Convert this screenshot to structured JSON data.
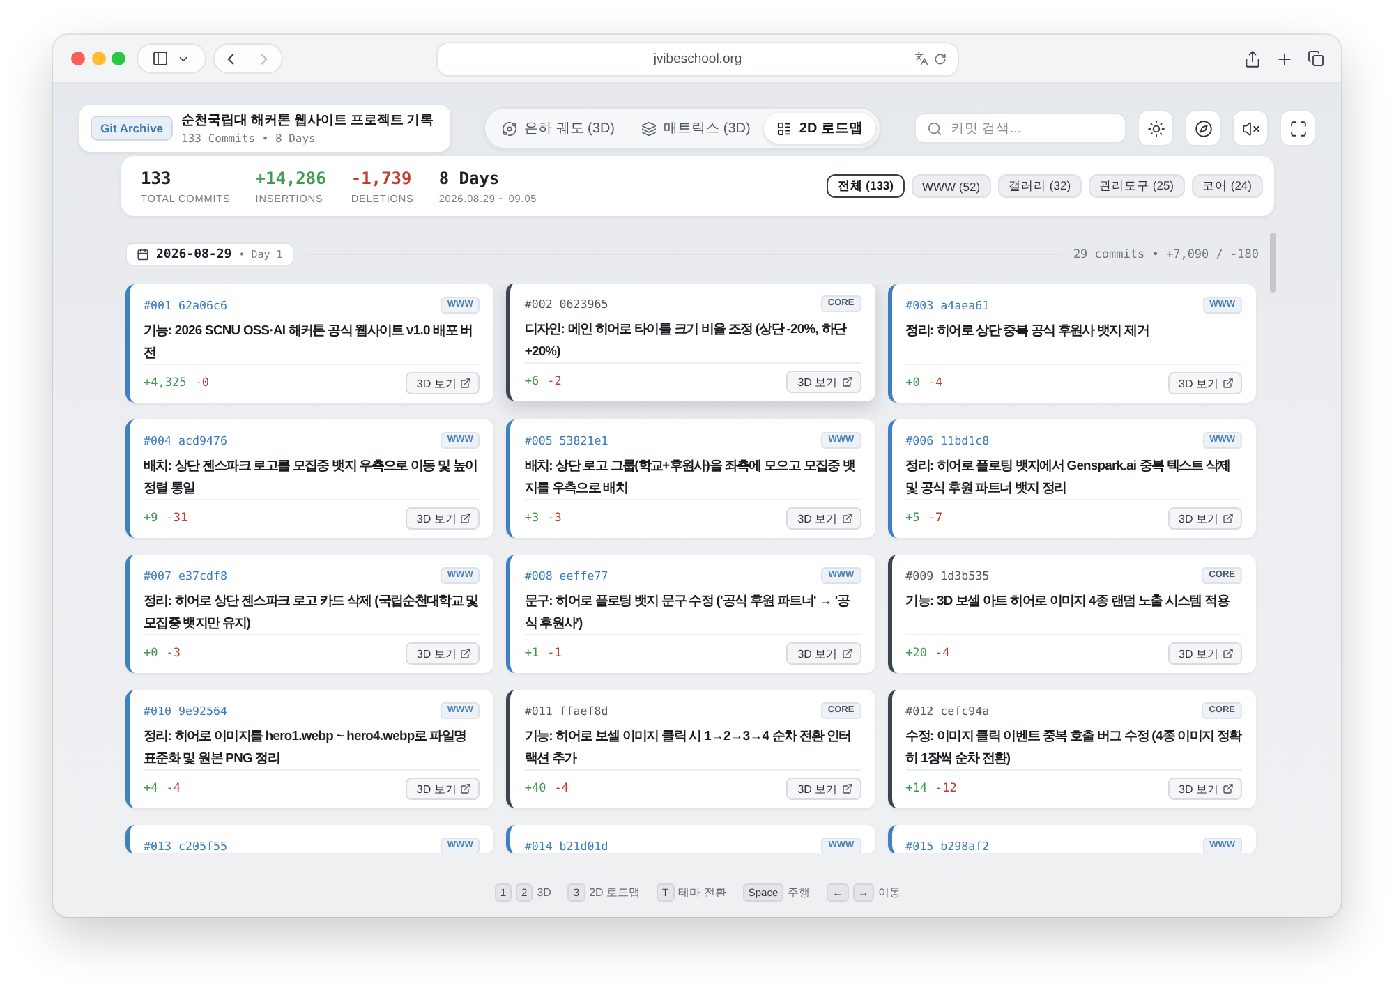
{
  "browser": {
    "url": "jvibeschool.org",
    "back_disabled": false,
    "forward_disabled": true
  },
  "header": {
    "badge": "Git Archive",
    "title": "순천국립대 해커톤 웹사이트 프로젝트 기록",
    "subtitle": "133 Commits • 8 Days"
  },
  "mode_tabs": [
    {
      "label": "은하 궤도 (3D)",
      "selected": false
    },
    {
      "label": "매트릭스 (3D)",
      "selected": false
    },
    {
      "label": "2D 로드맵",
      "selected": true
    }
  ],
  "search": {
    "placeholder": "커밋 검색..."
  },
  "stats": [
    {
      "value": "133",
      "label": "TOTAL COMMITS",
      "color": "#1c1f23"
    },
    {
      "value": "+14,286",
      "label": "INSERTIONS",
      "color": "#3e9b4f"
    },
    {
      "value": "-1,739",
      "label": "DELETIONS",
      "color": "#c23b2e"
    },
    {
      "value": "8 Days",
      "label": "2026.08.29 ~ 09.05",
      "color": "#1c1f23"
    }
  ],
  "filters": [
    {
      "label": "전체 (133)",
      "selected": true
    },
    {
      "label": "WWW (52)",
      "selected": false
    },
    {
      "label": "갤러리 (32)",
      "selected": false
    },
    {
      "label": "관리도구 (25)",
      "selected": false
    },
    {
      "label": "코어 (24)",
      "selected": false
    }
  ],
  "day": {
    "date": "2026-08-29",
    "sub": "• Day 1",
    "summary": "29 commits • +7,090 / -180"
  },
  "commits": [
    {
      "ref": "#001 62a06c6",
      "tag": "WWW",
      "kind": "www",
      "hovered": false,
      "title": "기능: 2026 SCNU OSS·AI 해커톤 공식 웹사이트 v1.0 배포 버전",
      "insertions": "+4,325",
      "deletions": "-0",
      "action": "3D 보기"
    },
    {
      "ref": "#002 0623965",
      "tag": "CORE",
      "kind": "core",
      "hovered": true,
      "title": "디자인: 메인 히어로 타이틀 크기 비율 조정 (상단 -20%, 하단 +20%)",
      "insertions": "+6",
      "deletions": "-2",
      "action": "3D 보기"
    },
    {
      "ref": "#003 a4aea61",
      "tag": "WWW",
      "kind": "www",
      "hovered": false,
      "title": "정리: 히어로 상단 중복 공식 후원사 뱃지 제거",
      "insertions": "+0",
      "deletions": "-4",
      "action": "3D 보기"
    },
    {
      "ref": "#004 acd9476",
      "tag": "WWW",
      "kind": "www",
      "hovered": false,
      "title": "배치: 상단 젠스파크 로고를 모집중 뱃지 우측으로 이동 및 높이 정렬 통일",
      "insertions": "+9",
      "deletions": "-31",
      "action": "3D 보기"
    },
    {
      "ref": "#005 53821e1",
      "tag": "WWW",
      "kind": "www",
      "hovered": false,
      "title": "배치: 상단 로고 그룹(학교+후원사)을 좌측에 모으고 모집중 뱃지를 우측으로 배치",
      "insertions": "+3",
      "deletions": "-3",
      "action": "3D 보기"
    },
    {
      "ref": "#006 11bd1c8",
      "tag": "WWW",
      "kind": "www",
      "hovered": false,
      "title": "정리: 히어로 플로팅 뱃지에서 Genspark.ai 중복 텍스트 삭제 및 공식 후원 파트너 뱃지 정리",
      "insertions": "+5",
      "deletions": "-7",
      "action": "3D 보기"
    },
    {
      "ref": "#007 e37cdf8",
      "tag": "WWW",
      "kind": "www",
      "hovered": false,
      "title": "정리: 히어로 상단 젠스파크 로고 카드 삭제 (국립순천대학교 및 모집중 뱃지만 유지)",
      "insertions": "+0",
      "deletions": "-3",
      "action": "3D 보기"
    },
    {
      "ref": "#008 eeffe77",
      "tag": "WWW",
      "kind": "www",
      "hovered": false,
      "title": "문구: 히어로 플로팅 뱃지 문구 수정 ('공식 후원 파트너' → '공식 후원사')",
      "insertions": "+1",
      "deletions": "-1",
      "action": "3D 보기"
    },
    {
      "ref": "#009 1d3b535",
      "tag": "CORE",
      "kind": "core",
      "hovered": false,
      "title": "기능: 3D 보셀 아트 히어로 이미지 4종 랜덤 노출 시스템 적용",
      "insertions": "+20",
      "deletions": "-4",
      "action": "3D 보기"
    },
    {
      "ref": "#010 9e92564",
      "tag": "WWW",
      "kind": "www",
      "hovered": false,
      "title": "정리: 히어로 이미지를 hero1.webp ~ hero4.webp로 파일명 표준화 및 원본 PNG 정리",
      "insertions": "+4",
      "deletions": "-4",
      "action": "3D 보기"
    },
    {
      "ref": "#011 ffaef8d",
      "tag": "CORE",
      "kind": "core",
      "hovered": false,
      "title": "기능: 히어로 보셀 이미지 클릭 시 1→2→3→4 순차 전환 인터랙션 추가",
      "insertions": "+40",
      "deletions": "-4",
      "action": "3D 보기"
    },
    {
      "ref": "#012 cefc94a",
      "tag": "CORE",
      "kind": "core",
      "hovered": false,
      "title": "수정: 이미지 클릭 이벤트 중복 호출 버그 수정 (4종 이미지 정확히 1장씩 순차 전환)",
      "insertions": "+14",
      "deletions": "-12",
      "action": "3D 보기"
    },
    {
      "ref": "#013 c205f55",
      "tag": "WWW",
      "kind": "www",
      "hovered": false
    },
    {
      "ref": "#014 b21d01d",
      "tag": "WWW",
      "kind": "www",
      "hovered": false
    },
    {
      "ref": "#015 b298af2",
      "tag": "WWW",
      "kind": "www",
      "hovered": false
    }
  ],
  "shortcuts": [
    {
      "keys": [
        "1",
        "2"
      ],
      "label": "3D"
    },
    {
      "keys": [
        "3"
      ],
      "label": "2D 로드맵"
    },
    {
      "keys": [
        "T"
      ],
      "label": "테마 전환"
    },
    {
      "keys": [
        "Space"
      ],
      "label": "주행"
    },
    {
      "keys": [
        "←",
        "→"
      ],
      "label": "이동"
    }
  ]
}
